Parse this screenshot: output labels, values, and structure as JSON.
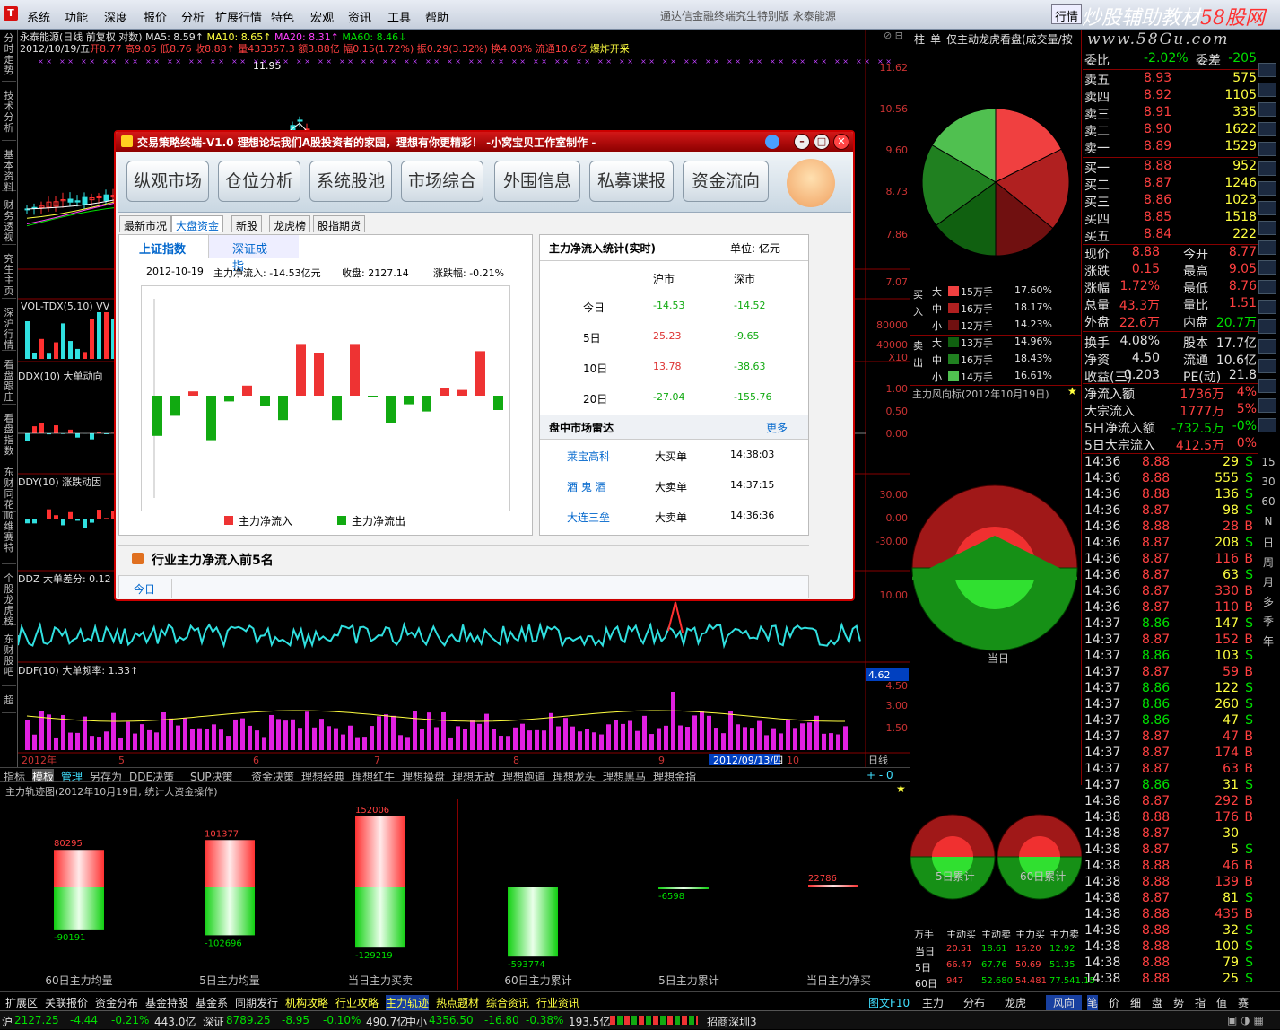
{
  "menubar": {
    "logo": "T",
    "items": [
      "系统",
      "功能",
      "深度",
      "报价",
      "分析",
      "扩展行情",
      "特色",
      "宏观",
      "资讯",
      "工具",
      "帮助"
    ],
    "title": "通达信金融终端究生特别版  永泰能源",
    "mode": "行情"
  },
  "watermark": {
    "line1a": "炒股辅助教材",
    "line1b": "58股网",
    "line2": "www.58Gu.com"
  },
  "lefttabs": [
    "分时走势",
    "技术分析",
    "基本资料",
    "财务透视",
    "究生主页",
    "深沪行情",
    "看盘跟庄",
    "看盘指数",
    "东财同花顺",
    "维赛特",
    "个股龙虎榜",
    "东财股吧",
    "超"
  ],
  "chart": {
    "line1": "永泰能源(日线 前复权 对数)",
    "ma5": "MA5: 8.59↑",
    "ma10": "MA10: 8.65↑",
    "ma20": "MA20: 8.31↑",
    "ma60": "MA60: 8.46↓",
    "line2a": "2012/10/19/五",
    "line2b": "开8.77 高9.05 低8.76 收8.88↑ 量433357.3 额3.88亿 幅0.15(1.72%) 振0.29(3.32%) 换4.08% 流通10.6亿",
    "line2c": "爆炸开采",
    "peak": "11.95",
    "price_axis": [
      "11.62",
      "10.56",
      "9.60",
      "8.73",
      "7.86",
      "7.07"
    ],
    "vol_label": "VOL-TDX(5,10) VV",
    "vol_axis": [
      "80000",
      "40000",
      "X10"
    ],
    "ddx_label": "DDX(10) 大单动向",
    "ddx_axis": [
      "1.00",
      "0.50",
      "0.00"
    ],
    "ddy_label": "DDY(10) 涨跌动因",
    "ddy_axis": [
      "30.00",
      "0.00",
      "-30.00"
    ],
    "ddz_label": "DDZ 大单差分: 0.12",
    "ddz_axis": [
      "10.00"
    ],
    "ddf_label": "DDF(10) 大单频率: 1.33↑",
    "ddf_axis": [
      "4.62",
      "4.50",
      "3.00",
      "1.50"
    ],
    "xaxis": [
      "2012年",
      "5",
      "6",
      "7",
      "8",
      "9",
      "2012/09/13/四",
      "10"
    ],
    "period": "日线"
  },
  "dialog": {
    "title": "交易策略终端-V1.0  理想论坛我们A股投资者的家园，理想有你更精彩！ -小窝宝贝工作室制作 -",
    "toolbar": [
      "纵观市场",
      "仓位分析",
      "系统股池",
      "市场综合",
      "外围信息",
      "私募谍报",
      "资金流向"
    ],
    "subtabs": [
      "最新市况",
      "大盘资金",
      "新股",
      "龙虎榜",
      "股指期货"
    ],
    "left": {
      "tab1": "上证指数",
      "tab2": "深证成指",
      "date": "2012-10-19",
      "inflow": "主力净流入: -14.53亿元",
      "close": "收盘: 2127.14",
      "change": "涨跌幅: -0.21%",
      "legend_in": "主力净流入",
      "legend_out": "主力净流出"
    },
    "flows": [
      -2.8,
      -1.4,
      0.3,
      -3.1,
      -0.4,
      0.7,
      -0.7,
      -1.7,
      3.6,
      3.0,
      -1.7,
      3.6,
      -0.1,
      -1.9,
      -0.6,
      -1.1,
      0.5,
      0.4,
      3.1,
      -1.0
    ],
    "right": {
      "title": "主力净流入统计(实时)",
      "unit": "单位: 亿元",
      "col1": "沪市",
      "col2": "深市",
      "rows": [
        {
          "label": "今日",
          "sh": "-14.53",
          "sz": "-14.52"
        },
        {
          "label": "5日",
          "sh": "25.23",
          "sz": "-9.65"
        },
        {
          "label": "10日",
          "sh": "13.78",
          "sz": "-38.63"
        },
        {
          "label": "20日",
          "sh": "-27.04",
          "sz": "-155.76"
        }
      ],
      "radar_title": "盘中市场雷达",
      "more": "更多",
      "radar": [
        {
          "name": "莱宝高科",
          "type": "大买单",
          "time": "14:38:03"
        },
        {
          "name": "酒 鬼 酒",
          "type": "大卖单",
          "time": "14:37:15"
        },
        {
          "name": "大连三垒",
          "type": "大卖单",
          "time": "14:36:36"
        }
      ]
    },
    "bottom_title": "行业主力净流入前5名",
    "bottom_tab": "今日"
  },
  "right_top": {
    "header": [
      "柱",
      "单",
      "仅主动",
      "龙虎看盘(成交量/按"
    ],
    "buy": [
      {
        "k": "大",
        "v": "15万手",
        "p": "17.60%"
      },
      {
        "k": "中",
        "v": "16万手",
        "p": "18.17%"
      },
      {
        "k": "小",
        "v": "12万手",
        "p": "14.23%"
      }
    ],
    "sell": [
      {
        "k": "大",
        "v": "13万手",
        "p": "14.96%"
      },
      {
        "k": "中",
        "v": "16万手",
        "p": "18.43%"
      },
      {
        "k": "小",
        "v": "14万手",
        "p": "16.61%"
      }
    ],
    "side_buy": "买入",
    "side_sell": "卖出",
    "wind_title": "主力风向标(2012年10月19日)",
    "today": "当日",
    "d5": "5日累计",
    "d60": "60日累计",
    "tbl_head": [
      "万手",
      "主动买",
      "主动卖",
      "主力买",
      "主力卖"
    ],
    "tbl_rows": [
      {
        "k": "当日",
        "v": [
          "20.51",
          "18.61",
          "15.20",
          "12.92"
        ]
      },
      {
        "k": "5日",
        "v": [
          "66.47",
          "67.76",
          "50.69",
          "51.35"
        ]
      },
      {
        "k": "60日",
        "v": [
          "947",
          "52.680",
          "54.481",
          "77.541.15"
        ]
      }
    ]
  },
  "quote": {
    "weibi": [
      "委比",
      "-2.02%",
      "委差",
      "-205"
    ],
    "asks": [
      [
        "卖五",
        "8.93",
        "575"
      ],
      [
        "卖四",
        "8.92",
        "1105"
      ],
      [
        "卖三",
        "8.91",
        "335"
      ],
      [
        "卖二",
        "8.90",
        "1622"
      ],
      [
        "卖一",
        "8.89",
        "1529"
      ]
    ],
    "bids": [
      [
        "买一",
        "8.88",
        "952"
      ],
      [
        "买二",
        "8.87",
        "1246"
      ],
      [
        "买三",
        "8.86",
        "1023"
      ],
      [
        "买四",
        "8.85",
        "1518"
      ],
      [
        "买五",
        "8.84",
        "222"
      ]
    ],
    "stats": [
      [
        "现价",
        "8.88",
        "今开",
        "8.77"
      ],
      [
        "涨跌",
        "0.15",
        "最高",
        "9.05"
      ],
      [
        "涨幅",
        "1.72%",
        "最低",
        "8.76"
      ],
      [
        "总量",
        "43.3万",
        "量比",
        "1.51"
      ],
      [
        "外盘",
        "22.6万",
        "内盘",
        "20.7万"
      ],
      [
        "换手",
        "4.08%",
        "股本",
        "17.7亿"
      ],
      [
        "净资",
        "4.50",
        "流通",
        "10.6亿"
      ],
      [
        "收益(三)",
        "0.203",
        "PE(动)",
        "21.8"
      ]
    ],
    "flows": [
      [
        "净流入额",
        "1736万",
        "4%"
      ],
      [
        "大宗流入",
        "1777万",
        "5%"
      ],
      [
        "5日净流入额",
        "-732.5万",
        "-0%"
      ],
      [
        "5日大宗流入",
        "412.5万",
        "0%"
      ]
    ],
    "ticks": [
      [
        "14:36",
        "8.88",
        "29",
        "S"
      ],
      [
        "14:36",
        "8.88",
        "555",
        "S"
      ],
      [
        "14:36",
        "8.88",
        "136",
        "S"
      ],
      [
        "14:36",
        "8.87",
        "98",
        "S"
      ],
      [
        "14:36",
        "8.88",
        "28",
        "B"
      ],
      [
        "14:36",
        "8.87",
        "208",
        "S"
      ],
      [
        "14:36",
        "8.87",
        "116",
        "B"
      ],
      [
        "14:36",
        "8.87",
        "63",
        "S"
      ],
      [
        "14:36",
        "8.87",
        "330",
        "B"
      ],
      [
        "14:36",
        "8.87",
        "110",
        "B"
      ],
      [
        "14:37",
        "8.86",
        "147",
        "S"
      ],
      [
        "14:37",
        "8.87",
        "152",
        "B"
      ],
      [
        "14:37",
        "8.86",
        "103",
        "S"
      ],
      [
        "14:37",
        "8.87",
        "59",
        "B"
      ],
      [
        "14:37",
        "8.86",
        "122",
        "S"
      ],
      [
        "14:37",
        "8.86",
        "260",
        "S"
      ],
      [
        "14:37",
        "8.86",
        "47",
        "S"
      ],
      [
        "14:37",
        "8.87",
        "47",
        "B"
      ],
      [
        "14:37",
        "8.87",
        "174",
        "B"
      ],
      [
        "14:37",
        "8.87",
        "63",
        "B"
      ],
      [
        "14:37",
        "8.86",
        "31",
        "S"
      ],
      [
        "14:38",
        "8.87",
        "292",
        "B"
      ],
      [
        "14:38",
        "8.88",
        "176",
        "B"
      ],
      [
        "14:38",
        "8.87",
        "30",
        ""
      ],
      [
        "14:38",
        "8.87",
        "5",
        "S"
      ],
      [
        "14:38",
        "8.88",
        "46",
        "B"
      ],
      [
        "14:38",
        "8.88",
        "139",
        "B"
      ],
      [
        "14:38",
        "8.87",
        "81",
        "S"
      ],
      [
        "14:38",
        "8.88",
        "435",
        "B"
      ],
      [
        "14:38",
        "8.88",
        "32",
        "S"
      ],
      [
        "14:38",
        "8.88",
        "100",
        "S"
      ],
      [
        "14:38",
        "8.88",
        "79",
        "S"
      ],
      [
        "14:38",
        "8.88",
        "25",
        "S"
      ]
    ],
    "vtabs": [
      "15",
      "30",
      "60",
      "N",
      "日",
      "周",
      "月",
      "多",
      "季",
      "年"
    ]
  },
  "btabs": [
    "指标",
    "模板",
    "管理",
    "另存为",
    "DDE决策",
    "SUP决策",
    "资金决策",
    "理想经典",
    "理想红牛",
    "理想操盘",
    "理想无敌",
    "理想跑道",
    "理想龙头",
    "理想黑马",
    "理想金指"
  ],
  "btabs_right": "+ - 0",
  "bottom": {
    "title": "主力轨迹图(2012年10月19日, 统计大资金操作)",
    "bars": [
      {
        "label": "60日主力均量",
        "up": "80295",
        "down": "-90191"
      },
      {
        "label": "5日主力均量",
        "up": "101377",
        "down": "-102696"
      },
      {
        "label": "当日主力买卖",
        "up": "152006",
        "down": "-129219"
      }
    ],
    "net": [
      {
        "label": "60日主力累计",
        "v": "-593774"
      },
      {
        "label": "5日主力累计",
        "v": "-6598"
      },
      {
        "label": "当日主力净买",
        "v": "22786"
      }
    ]
  },
  "status": {
    "tabs": [
      "扩展区",
      "关联报价",
      "资金分布",
      "基金持股",
      "基金系",
      "同期发行",
      "机构攻略",
      "行业攻略",
      "主力轨迹",
      "热点题材",
      "综合资讯",
      "行业资讯"
    ],
    "fkey": "图文F10",
    "rtabs": [
      "主力",
      "分布",
      "龙虎",
      "风向"
    ],
    "qtabs": [
      "笔",
      "价",
      "细",
      "盘",
      "势",
      "指",
      "值",
      "赛"
    ],
    "idx": [
      {
        "n": "沪",
        "v": "2127.25",
        "c": "-4.44",
        "p": "-0.21%",
        "a": "443.0亿"
      },
      {
        "n": "深证",
        "v": "8789.25",
        "c": "-8.95",
        "p": "-0.10%",
        "a": "490.7亿"
      },
      {
        "n": "中小",
        "v": "4356.50",
        "c": "-16.80",
        "p": "-0.38%",
        "a": "193.5亿"
      }
    ],
    "broker": "招商深圳3"
  },
  "colors": {
    "up": "#ff4040",
    "down": "#00c000",
    "grid": "#800000",
    "accent": "#c00000"
  }
}
